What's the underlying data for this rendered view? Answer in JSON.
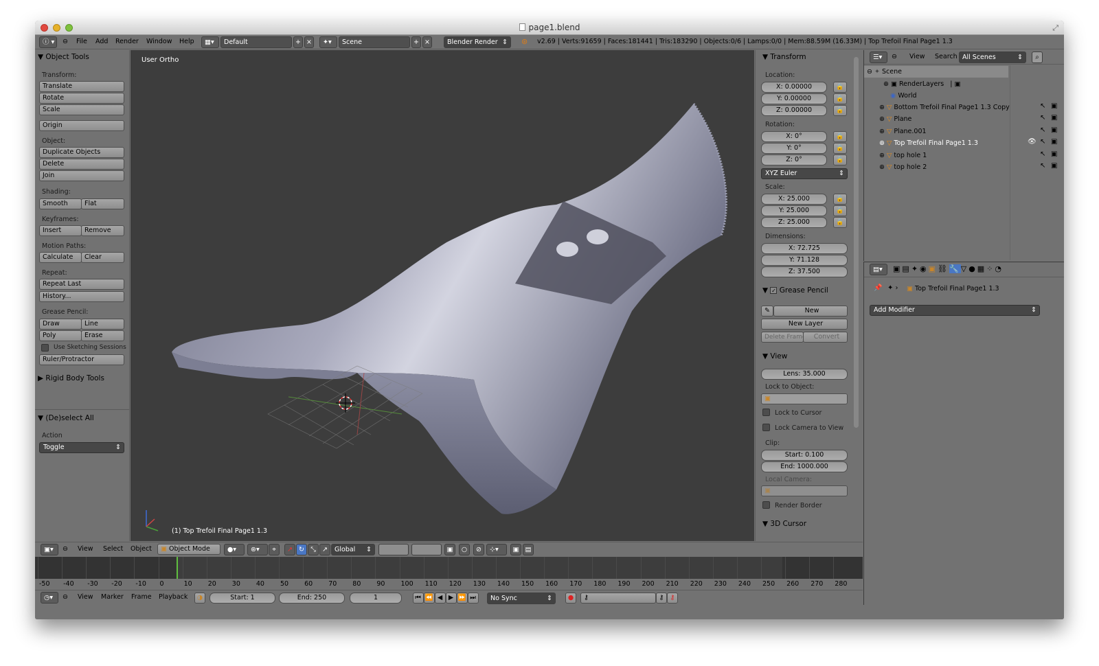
{
  "window": {
    "title": "page1.blend"
  },
  "menubar": {
    "menus": [
      "File",
      "Add",
      "Render",
      "Window",
      "Help"
    ],
    "layout": "Default",
    "scene": "Scene",
    "engine": "Blender Render",
    "stats": "v2.69 | Verts:91659 | Faces:181441 | Tris:183290 | Objects:0/6 | Lamps:0/0 | Mem:88.59M (16.33M) | Top Trefoil Final Page1 1.3"
  },
  "tools": {
    "header": "Object Tools",
    "transform_label": "Transform:",
    "translate": "Translate",
    "rotate": "Rotate",
    "scale": "Scale",
    "origin": "Origin",
    "object_label": "Object:",
    "duplicate": "Duplicate Objects",
    "delete": "Delete",
    "join": "Join",
    "shading_label": "Shading:",
    "smooth": "Smooth",
    "flat": "Flat",
    "keyframes_label": "Keyframes:",
    "insert": "Insert",
    "remove": "Remove",
    "motion_label": "Motion Paths:",
    "calculate": "Calculate",
    "clear": "Clear",
    "repeat_label": "Repeat:",
    "repeat_last": "Repeat Last",
    "history": "History...",
    "grease_label": "Grease Pencil:",
    "draw": "Draw",
    "line": "Line",
    "poly": "Poly",
    "erase": "Erase",
    "sketching": "Use Sketching Sessions",
    "ruler": "Ruler/Protractor",
    "rigid": "Rigid Body Tools",
    "deselect_header": "(De)select All",
    "action_label": "Action",
    "action_value": "Toggle"
  },
  "viewport": {
    "view_label": "User Ortho",
    "object_label": "(1) Top Trefoil Final Page1 1.3"
  },
  "npanel": {
    "transform": "Transform",
    "location_label": "Location:",
    "loc_x": "X: 0.00000",
    "loc_y": "Y: 0.00000",
    "loc_z": "Z: 0.00000",
    "rotation_label": "Rotation:",
    "rot_x": "X: 0°",
    "rot_y": "Y: 0°",
    "rot_z": "Z: 0°",
    "rot_mode": "XYZ Euler",
    "scale_label": "Scale:",
    "sc_x": "X: 25.000",
    "sc_y": "Y: 25.000",
    "sc_z": "Z: 25.000",
    "dims_label": "Dimensions:",
    "dim_x": "X: 72.725",
    "dim_y": "Y: 71.128",
    "dim_z": "Z: 37.500",
    "grease": "Grease Pencil",
    "new": "New",
    "new_layer": "New Layer",
    "delete_frame": "Delete Frame",
    "convert": "Convert",
    "view": "View",
    "lens": "Lens: 35.000",
    "lock_obj_label": "Lock to Object:",
    "lock_cursor": "Lock to Cursor",
    "lock_cam": "Lock Camera to View",
    "clip_label": "Clip:",
    "clip_start": "Start: 0.100",
    "clip_end": "End: 1000.000",
    "local_cam": "Local Camera:",
    "render_border": "Render Border",
    "cursor_3d": "3D Cursor"
  },
  "outliner": {
    "menus": [
      "View",
      "Search"
    ],
    "scope": "All Scenes",
    "items": [
      "Scene",
      "RenderLayers",
      "World",
      "Bottom Trefoil Final Page1 1.3 Copy",
      "Plane",
      "Plane.001",
      "Top Trefoil Final Page1 1.3",
      "top hole 1",
      "top hole 2"
    ]
  },
  "properties": {
    "object_name": "Top Trefoil Final Page1 1.3",
    "add_modifier": "Add Modifier"
  },
  "view_header": {
    "menus": [
      "View",
      "Select",
      "Object"
    ],
    "mode": "Object Mode",
    "orientation": "Global"
  },
  "timeline": {
    "ticks": [
      "-50",
      "-40",
      "-30",
      "-20",
      "-10",
      "0",
      "10",
      "20",
      "30",
      "40",
      "50",
      "60",
      "70",
      "80",
      "90",
      "100",
      "110",
      "120",
      "130",
      "140",
      "150",
      "160",
      "170",
      "180",
      "190",
      "200",
      "210",
      "220",
      "230",
      "240",
      "250",
      "260",
      "270",
      "280"
    ],
    "current_frame_marker": 0,
    "range": [
      0,
      250
    ]
  },
  "timeline_header": {
    "menus": [
      "View",
      "Marker",
      "Frame",
      "Playback"
    ],
    "start": "Start: 1",
    "end": "End: 250",
    "current": "1",
    "sync": "No Sync"
  }
}
